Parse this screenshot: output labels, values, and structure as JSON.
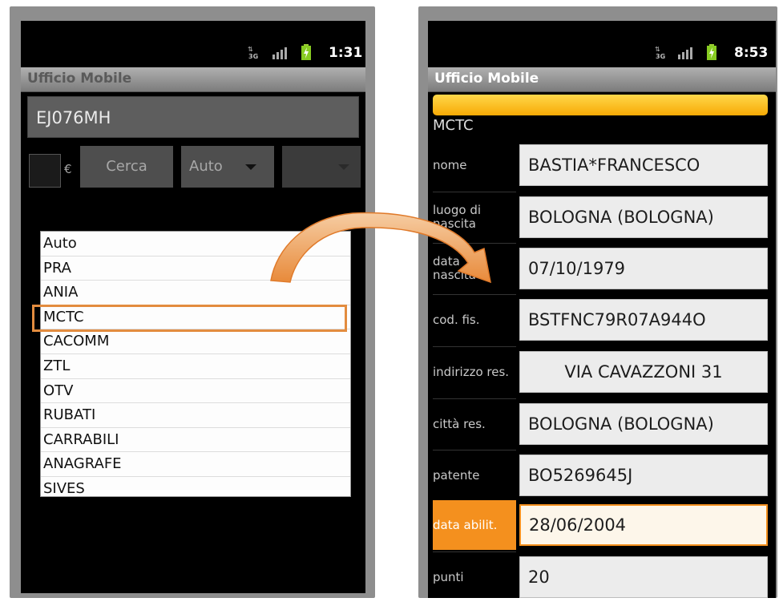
{
  "left_phone": {
    "status_time": "1:31",
    "app_title": "Ufficio Mobile",
    "plate_value": "EJ076MH",
    "currency_symbol": "€",
    "search_label": "Cerca",
    "type_selected": "Auto",
    "list_items": [
      "Auto",
      "PRA",
      "ANIA",
      "MCTC",
      "CACOMM",
      "ZTL",
      "OTV",
      "RUBATI",
      "CARRABILI",
      "ANAGRAFE",
      "SIVES"
    ],
    "highlighted_item": "MCTC"
  },
  "right_phone": {
    "status_time": "8:53",
    "app_title": "Ufficio Mobile",
    "section_title": "MCTC",
    "fields": [
      {
        "label": "nome",
        "value": "BASTIA*FRANCESCO"
      },
      {
        "label": "luogo di nascita",
        "value": "BOLOGNA (BOLOGNA)"
      },
      {
        "label": "data nascita",
        "value": "07/10/1979"
      },
      {
        "label": "cod. fis.",
        "value": "BSTFNC79R07A944O"
      },
      {
        "label": "indirizzo res.",
        "value": "VIA CAVAZZONI 31"
      },
      {
        "label": "città res.",
        "value": "BOLOGNA (BOLOGNA)"
      },
      {
        "label": "patente",
        "value": "BO5269645J"
      },
      {
        "label": "data abilit.",
        "value": "28/06/2004"
      },
      {
        "label": "punti",
        "value": "20"
      }
    ]
  },
  "colors": {
    "accent_orange": "#f4901e",
    "progress_yellow": "#f7aa05",
    "highlight_border": "#e38c3f"
  },
  "icons": [
    "3g-icon",
    "signal-icon",
    "battery-charging-icon",
    "dropdown-arrow-icon",
    "curved-arrow-icon"
  ]
}
